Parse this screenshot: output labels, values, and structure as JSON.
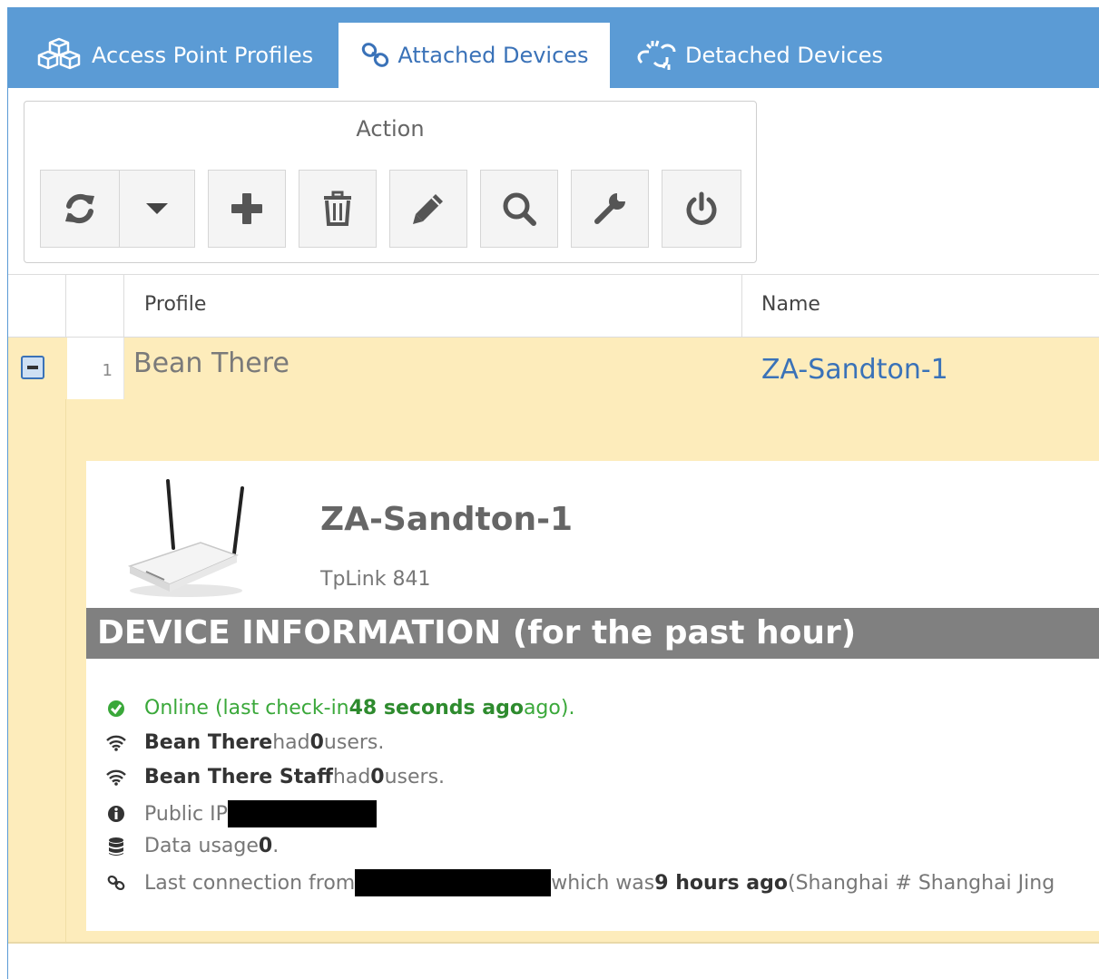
{
  "tabs": [
    {
      "label": "Access Point Profiles",
      "icon": "cubes-icon",
      "active": false
    },
    {
      "label": "Attached Devices",
      "icon": "link-icon",
      "active": true
    },
    {
      "label": "Detached Devices",
      "icon": "broken-link-icon",
      "active": false
    }
  ],
  "toolbar": {
    "title": "Action",
    "buttons": [
      "refresh-icon",
      "caret-down-icon",
      "plus-icon",
      "trash-icon",
      "pencil-icon",
      "search-icon",
      "wrench-icon",
      "power-icon"
    ]
  },
  "grid": {
    "columns": [
      "Profile",
      "Name"
    ],
    "rows": [
      {
        "num": "1",
        "profile": "Bean There",
        "name": "ZA-Sandton-1"
      }
    ]
  },
  "detail": {
    "device_name": "ZA-Sandton-1",
    "model": "TpLink 841",
    "section_title": "DEVICE INFORMATION (for the past hour)",
    "status": {
      "prefix": "Online (last check-in ",
      "value": "48 seconds ago",
      "suffix": " ago)."
    },
    "ssid1": {
      "name": "Bean There",
      "mid": " had ",
      "count": "0",
      "suffix": " users."
    },
    "ssid2": {
      "name": "Bean There Staff",
      "mid": " had ",
      "count": "0",
      "suffix": " users."
    },
    "public_ip_label": "Public IP",
    "data_usage": {
      "prefix": "Data usage ",
      "value": "0",
      "suffix": "."
    },
    "last_conn": {
      "prefix": "Last connection from ",
      "mid": "which was ",
      "value": "9 hours ago",
      "suffix": " (Shanghai # Shanghai Jing"
    }
  },
  "colors": {
    "tabbar": "#5b9bd5",
    "row_highlight": "#fdecbb",
    "link": "#3a72b8",
    "online": "#3aa83a",
    "info_bar": "#808080"
  }
}
